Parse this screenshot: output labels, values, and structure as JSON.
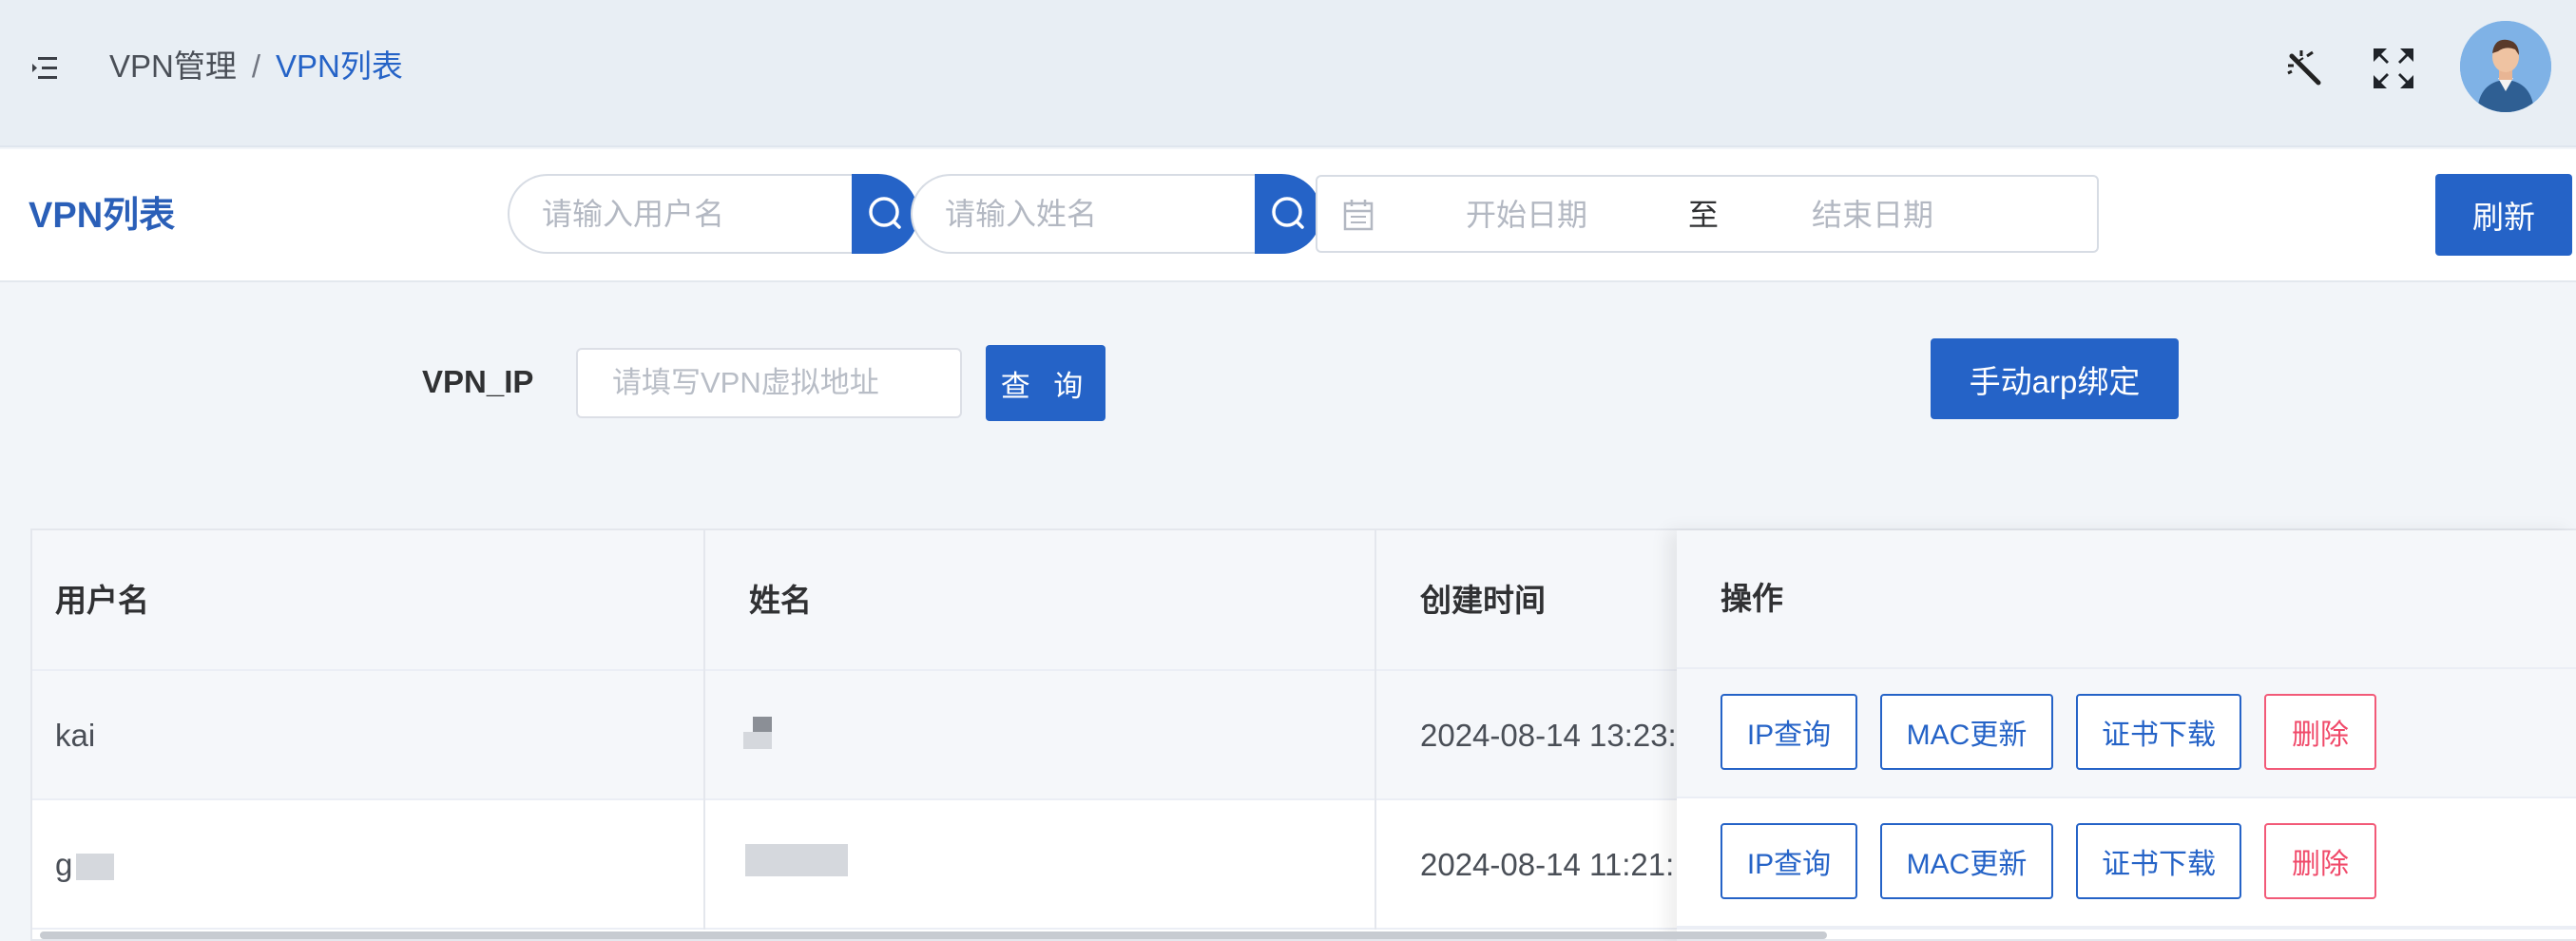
{
  "header": {
    "breadcrumb": {
      "parent": "VPN管理",
      "separator": "/",
      "current": "VPN列表"
    }
  },
  "filter": {
    "title": "VPN列表",
    "username_placeholder": "请输入用户名",
    "name_placeholder": "请输入姓名",
    "date_start_placeholder": "开始日期",
    "date_separator": "至",
    "date_end_placeholder": "结束日期",
    "refresh_label": "刷新"
  },
  "vpn_query": {
    "label": "VPN_IP",
    "placeholder": "请填写VPN虚拟地址",
    "query_label": "查 询",
    "arp_label": "手动arp绑定"
  },
  "table": {
    "columns": [
      "用户名",
      "姓名",
      "创建时间",
      "操作"
    ],
    "rows": [
      {
        "username": "kai",
        "name": "",
        "created": "2024-08-14 13:23:"
      },
      {
        "username": "g",
        "name": "",
        "created": "2024-08-14 11:21:"
      }
    ],
    "actions": [
      "IP查询",
      "MAC更新",
      "证书下载",
      "删除"
    ]
  },
  "colors": {
    "primary": "#2563c7",
    "danger": "#f04a6a",
    "header_bg": "#e8eef4"
  }
}
